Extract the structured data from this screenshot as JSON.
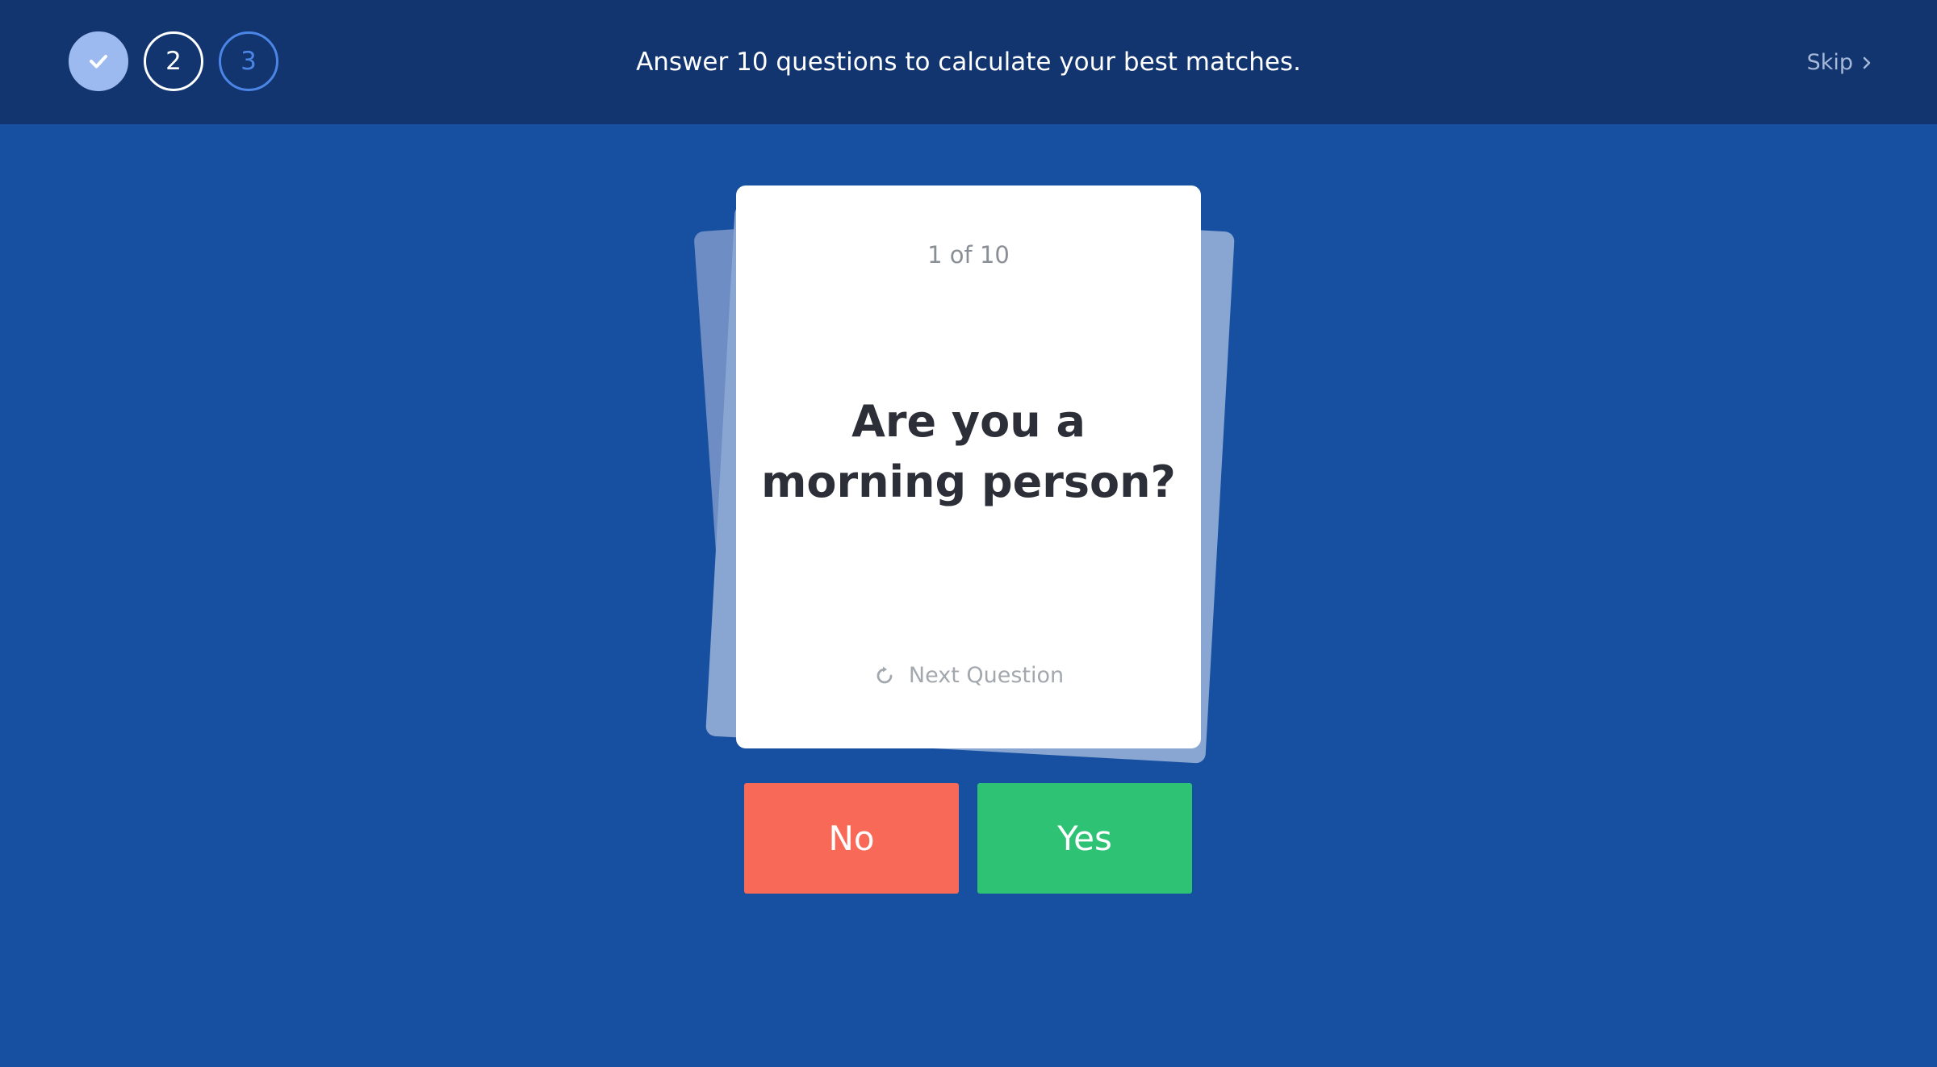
{
  "header": {
    "title": "Answer 10 questions to calculate your best matches.",
    "skip_label": "Skip",
    "steps": [
      {
        "label": "",
        "state": "done",
        "icon": "checkmark-icon"
      },
      {
        "label": "2",
        "state": "current"
      },
      {
        "label": "3",
        "state": "upcoming"
      }
    ]
  },
  "card": {
    "counter": "1 of 10",
    "question_line1": "Are you a",
    "question_line2": "morning person?",
    "next_question_label": "Next Question",
    "next_question_icon": "refresh-icon"
  },
  "answers": {
    "no_label": "No",
    "yes_label": "Yes"
  },
  "colors": {
    "background": "#1750a1",
    "header": "#123570",
    "no": "#f96957",
    "yes": "#2ec275",
    "step_done": "#9dbaf0",
    "step_upcoming": "#4b86e6"
  }
}
